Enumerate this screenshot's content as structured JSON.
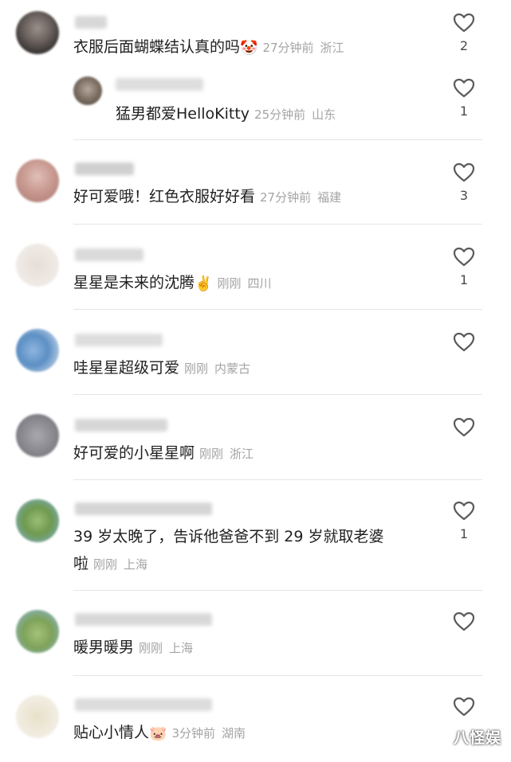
{
  "comments": [
    {
      "text": "衣服后面蝴蝶结认真的吗",
      "emoji": "🤡",
      "time": "27分钟前",
      "location": "浙江",
      "likes": "2",
      "reply": {
        "text": "猛男都爱HelloKitty",
        "time": "25分钟前",
        "location": "山东",
        "likes": "1"
      }
    },
    {
      "text": "好可爱哦！红色衣服好好看",
      "time": "27分钟前",
      "location": "福建",
      "likes": "3"
    },
    {
      "text": "星星是未来的沈腾",
      "emoji": "✌️",
      "time": "刚刚",
      "location": "四川",
      "likes": "1"
    },
    {
      "text": "哇星星超级可爱",
      "time": "刚刚",
      "location": "内蒙古",
      "likes": ""
    },
    {
      "text": "好可爱的小星星啊",
      "time": "刚刚",
      "location": "浙江",
      "likes": ""
    },
    {
      "text_line1": "39 岁太晚了，告诉他爸爸不到 29 岁就取老婆",
      "text_line2": "啦",
      "time": "刚刚",
      "location": "上海",
      "likes": "1"
    },
    {
      "text": "暖男暖男",
      "time": "刚刚",
      "location": "上海",
      "likes": ""
    },
    {
      "text": "贴心小情人",
      "emoji": "🐷",
      "time": "3分钟前",
      "location": "湖南",
      "likes": ""
    }
  ],
  "watermark": "八怪娱",
  "icons": {
    "like": "heart-outline-icon"
  },
  "colors": {
    "meta": "#a4a4a4",
    "divider": "#e6e6e6",
    "text": "#1f1f1f"
  }
}
